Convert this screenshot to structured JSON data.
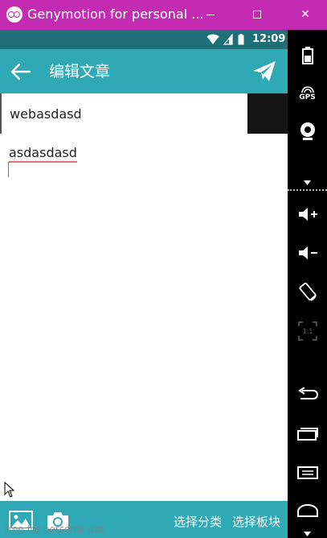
{
  "window": {
    "title": "Genymotion for personal ...",
    "minimize_icon": "minimize-icon",
    "maximize_icon": "maximize-icon",
    "close_glyph": "✕"
  },
  "status_bar": {
    "time": "12:09",
    "icons": [
      "wifi-icon",
      "signal-icon",
      "battery-icon"
    ]
  },
  "toolbar": {
    "title": "编辑文章",
    "back_icon": "back-arrow-icon",
    "send_icon": "send-icon"
  },
  "editor": {
    "title_value": "webasdasd",
    "body_value": "asdasdasd"
  },
  "bottom_bar": {
    "image_icon": "image-icon",
    "camera_icon": "camera-icon",
    "select_category": "选择分类",
    "select_board": "选择板块"
  },
  "watermark": "free for personal use",
  "side_panel": {
    "gps_label": "GPS",
    "ratio_label": "1:1",
    "icons": [
      "battery-icon",
      "gps-icon",
      "webcam-icon",
      "volume-up-icon",
      "volume-down-icon",
      "rotate-icon",
      "pixel-perfect-icon",
      "back-icon",
      "recent-apps-icon",
      "menu-icon",
      "home-icon"
    ]
  },
  "colors": {
    "window_bar": "#c42bb3",
    "status_bar": "#1f6f78",
    "accent": "#2ea9b5"
  }
}
